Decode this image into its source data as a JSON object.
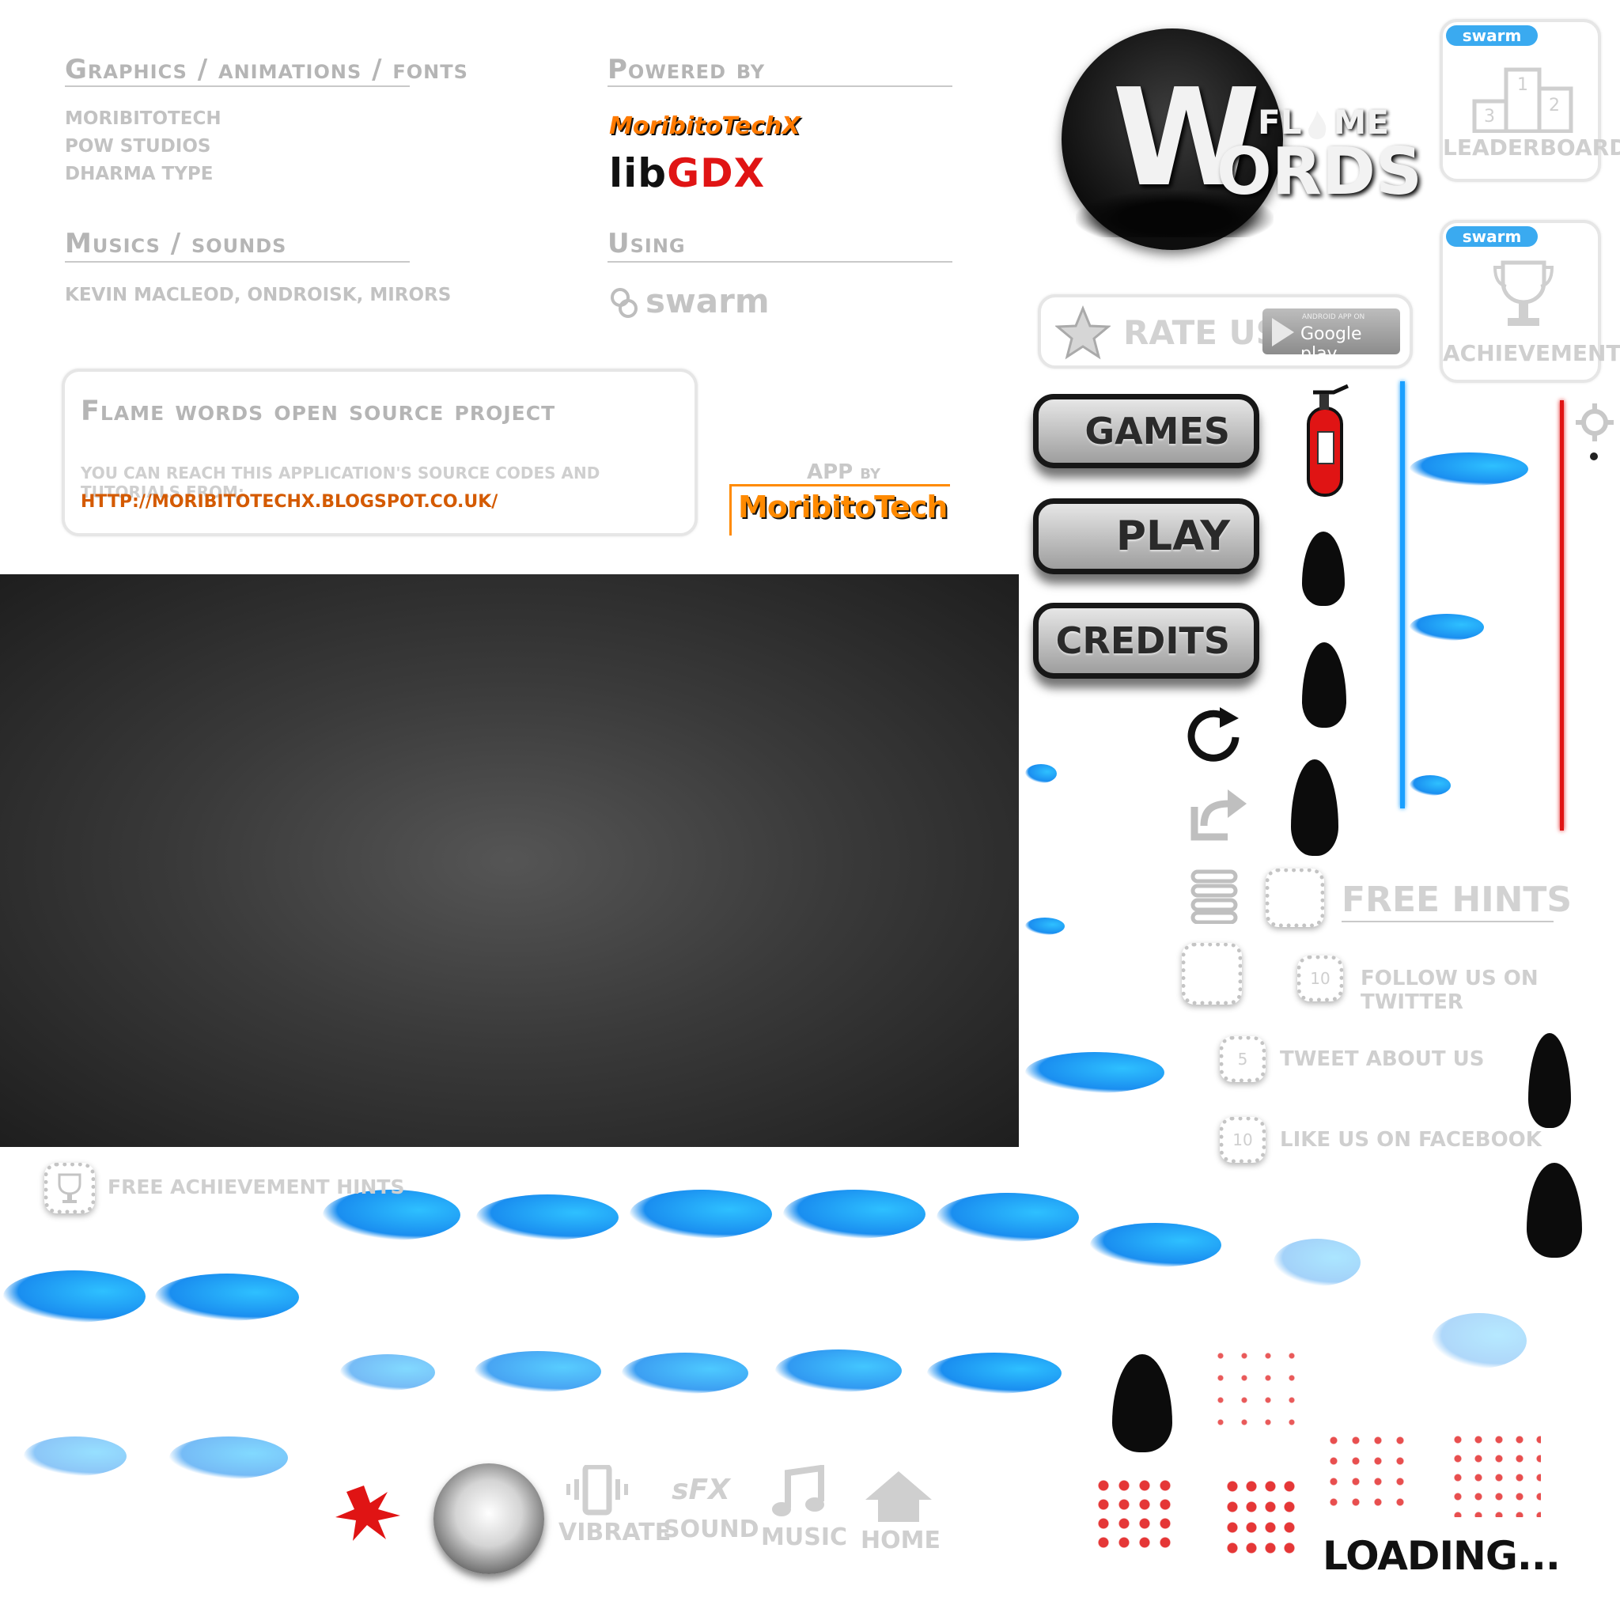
{
  "credits": {
    "graphics_heading": "Graphics / animations / fonts",
    "graphics_items": [
      "MORIBITOTECH",
      "POW STUDIOS",
      "DHARMA TYPE"
    ],
    "musics_heading": "Musics / sounds",
    "musics_items": "KEVIN MACLEOD, ONDROISK, MIRORS",
    "powered_heading": "Powered by",
    "powered_logo_1": "MoribitoTechX",
    "powered_logo_2_a": "lib",
    "powered_logo_2_b": "GDX",
    "using_heading": "Using",
    "using_logo": "swarm"
  },
  "source_panel": {
    "title": "Flame words open source project",
    "text": "YOU CAN REACH THIS APPLICATION'S SOURCE CODES AND TUTORIALS FROM;",
    "link": "HTTP://MORIBITOTECHX.BLOGSPOT.CO.UK/"
  },
  "app_by": {
    "label": "APP",
    "label_small": "BY",
    "brand": "MoribitoTech"
  },
  "logo": {
    "big_letter": "W",
    "word_top": "FL",
    "word_top_end": "ME",
    "word_bottom": "ORDS"
  },
  "swarm_panels": [
    {
      "badge": "swarm",
      "label": "LEADERBOARD",
      "podium": [
        "1",
        "2",
        "3"
      ]
    },
    {
      "badge": "swarm",
      "label": "ACHIEVEMENTS"
    }
  ],
  "rate": {
    "label": "RATE US",
    "store_small": "ANDROID APP ON",
    "store": "Google play"
  },
  "menu_buttons": [
    "GAMES",
    "PLAY",
    "CREDITS"
  ],
  "hints": {
    "free_hints": "FREE HINTS",
    "rows": [
      {
        "count": "10",
        "label": "FOLLOW US ON TWITTER"
      },
      {
        "count": "5",
        "label": "TWEET ABOUT US"
      },
      {
        "count": "10",
        "label": "LIKE US ON FACEBOOK"
      }
    ],
    "achievement_hints": "FREE ACHIEVEMENT HINTS"
  },
  "toggles": [
    {
      "label": "VIBRATE",
      "icon": "vibrate-icon"
    },
    {
      "label": "SOUND",
      "icon": "sfx-icon",
      "glyph": "sFX"
    },
    {
      "label": "MUSIC",
      "icon": "music-note-icon"
    },
    {
      "label": "HOME",
      "icon": "home-icon"
    }
  ],
  "loading": "LOADING...",
  "colors": {
    "link": "#d45a00",
    "accent_blue": "#1aa0ff",
    "red": "#e01414",
    "panel_border": "#e6e6e6",
    "swarm_blue": "#3aaaf0"
  }
}
